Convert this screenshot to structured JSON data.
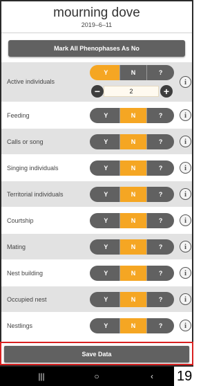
{
  "header": {
    "title": "mourning dove",
    "date": "2019–6–11"
  },
  "mark_all_label": "Mark All Phenophases As No",
  "phenophases": [
    {
      "label": "Active individuals",
      "y": "Y",
      "n": "N",
      "q": "?",
      "selected": "Y",
      "count": "2"
    },
    {
      "label": "Feeding",
      "y": "Y",
      "n": "N",
      "q": "?",
      "selected": "N"
    },
    {
      "label": "Calls or song",
      "y": "Y",
      "n": "N",
      "q": "?",
      "selected": "N"
    },
    {
      "label": "Singing individuals",
      "y": "Y",
      "n": "N",
      "q": "?",
      "selected": "N"
    },
    {
      "label": "Territorial individuals",
      "y": "Y",
      "n": "N",
      "q": "?",
      "selected": "N"
    },
    {
      "label": "Courtship",
      "y": "Y",
      "n": "N",
      "q": "?",
      "selected": "N"
    },
    {
      "label": "Mating",
      "y": "Y",
      "n": "N",
      "q": "?",
      "selected": "N"
    },
    {
      "label": "Nest building",
      "y": "Y",
      "n": "N",
      "q": "?",
      "selected": "N"
    },
    {
      "label": "Occupied nest",
      "y": "Y",
      "n": "N",
      "q": "?",
      "selected": "N"
    },
    {
      "label": "Nestlings",
      "y": "Y",
      "n": "N",
      "q": "?",
      "selected": "N"
    }
  ],
  "icons": {
    "info": "i",
    "minus": "−",
    "plus": "+"
  },
  "save_label": "Save Data",
  "nav": {
    "recents": "|||",
    "home": "○",
    "back": "‹"
  },
  "corner_number": "19",
  "colors": {
    "selected": "#f5a623",
    "unselected": "#616161",
    "highlight_border": "#d82020"
  }
}
